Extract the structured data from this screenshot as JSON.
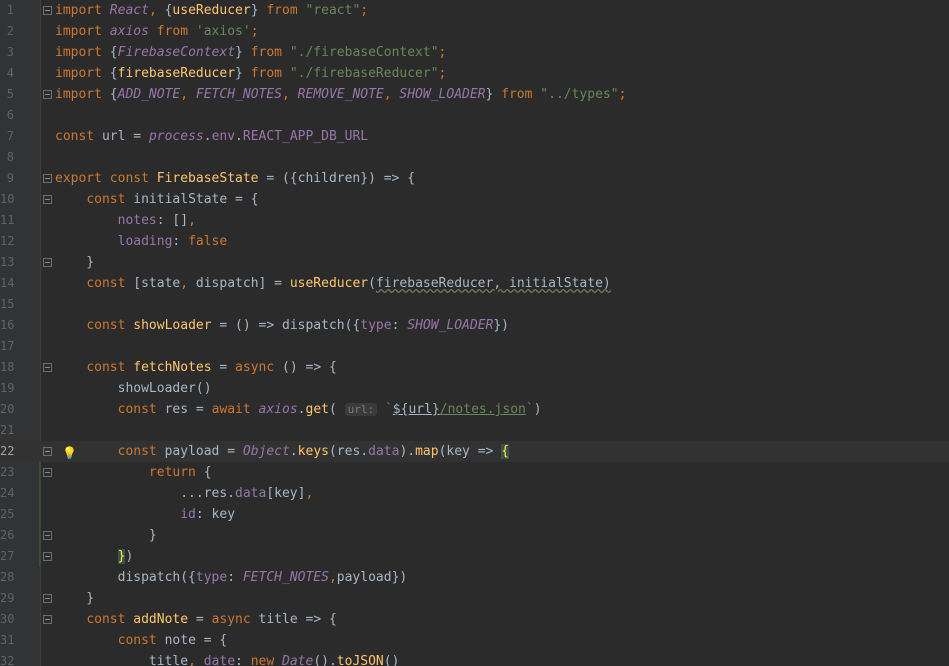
{
  "editor": {
    "current_line": 22,
    "lines": [
      {
        "n": "1",
        "tokens": [
          [
            "kw",
            "import "
          ],
          [
            "it",
            "React"
          ],
          [
            "kw",
            ", "
          ],
          [
            "pl",
            "{"
          ],
          [
            "fn",
            "useReducer"
          ],
          [
            "pl",
            "} "
          ],
          [
            "kw",
            "from "
          ],
          [
            "str",
            "\"react\""
          ],
          [
            "kw",
            ";"
          ]
        ]
      },
      {
        "n": "2",
        "tokens": [
          [
            "kw",
            "import "
          ],
          [
            "it",
            "axios "
          ],
          [
            "kw",
            "from "
          ],
          [
            "str",
            "'axios'"
          ],
          [
            "kw",
            ";"
          ]
        ]
      },
      {
        "n": "3",
        "tokens": [
          [
            "kw",
            "import "
          ],
          [
            "pl",
            "{"
          ],
          [
            "it",
            "FirebaseContext"
          ],
          [
            "pl",
            "} "
          ],
          [
            "kw",
            "from "
          ],
          [
            "str",
            "\"./firebaseContext\""
          ],
          [
            "kw",
            ";"
          ]
        ]
      },
      {
        "n": "4",
        "tokens": [
          [
            "kw",
            "import "
          ],
          [
            "pl",
            "{"
          ],
          [
            "fn",
            "firebaseReducer"
          ],
          [
            "pl",
            "} "
          ],
          [
            "kw",
            "from "
          ],
          [
            "str",
            "\"./firebaseReducer\""
          ],
          [
            "kw",
            ";"
          ]
        ]
      },
      {
        "n": "5",
        "tokens": [
          [
            "kw",
            "import "
          ],
          [
            "pl",
            "{"
          ],
          [
            "it",
            "ADD_NOTE"
          ],
          [
            "kw",
            ", "
          ],
          [
            "it",
            "FETCH_NOTES"
          ],
          [
            "kw",
            ", "
          ],
          [
            "it",
            "REMOVE_NOTE"
          ],
          [
            "kw",
            ", "
          ],
          [
            "it",
            "SHOW_LOADER"
          ],
          [
            "pl",
            "} "
          ],
          [
            "kw",
            "from "
          ],
          [
            "str",
            "\"../types\""
          ],
          [
            "kw",
            ";"
          ]
        ]
      },
      {
        "n": "6",
        "tokens": []
      },
      {
        "n": "7",
        "tokens": [
          [
            "kw",
            "const "
          ],
          [
            "pl",
            "url = "
          ],
          [
            "it",
            "process"
          ],
          [
            "pl",
            "."
          ],
          [
            "prop",
            "env"
          ],
          [
            "pl",
            "."
          ],
          [
            "prop",
            "REACT_APP_DB_URL"
          ]
        ]
      },
      {
        "n": "8",
        "tokens": []
      },
      {
        "n": "9",
        "tokens": [
          [
            "kw",
            "export const "
          ],
          [
            "fn",
            "FirebaseState"
          ],
          [
            "pl",
            " = ({children}) => {"
          ]
        ]
      },
      {
        "n": "10",
        "tokens": [
          [
            "pl",
            "    "
          ],
          [
            "kw",
            "const "
          ],
          [
            "pl",
            "initialState = {"
          ]
        ]
      },
      {
        "n": "11",
        "tokens": [
          [
            "pl",
            "        "
          ],
          [
            "prop",
            "notes"
          ],
          [
            "pl",
            ": []"
          ],
          [
            "kw",
            ","
          ]
        ]
      },
      {
        "n": "12",
        "tokens": [
          [
            "pl",
            "        "
          ],
          [
            "prop",
            "loading"
          ],
          [
            "pl",
            ": "
          ],
          [
            "kw",
            "false"
          ]
        ]
      },
      {
        "n": "13",
        "tokens": [
          [
            "pl",
            "    }"
          ]
        ]
      },
      {
        "n": "14",
        "tokens": [
          [
            "pl",
            "    "
          ],
          [
            "kw",
            "const "
          ],
          [
            "pl",
            "[state"
          ],
          [
            "kw",
            ", "
          ],
          [
            "pl",
            "dispatch] = "
          ],
          [
            "fn",
            "useReducer"
          ],
          [
            "pl",
            "("
          ],
          [
            "wave",
            "firebaseReducer, initialState)"
          ]
        ]
      },
      {
        "n": "15",
        "tokens": []
      },
      {
        "n": "16",
        "tokens": [
          [
            "pl",
            "    "
          ],
          [
            "kw",
            "const "
          ],
          [
            "fn",
            "showLoader"
          ],
          [
            "pl",
            " = () => dispatch({"
          ],
          [
            "prop",
            "type"
          ],
          [
            "pl",
            ": "
          ],
          [
            "it",
            "SHOW_LOADER"
          ],
          [
            "pl",
            "})"
          ]
        ]
      },
      {
        "n": "17",
        "tokens": []
      },
      {
        "n": "18",
        "tokens": [
          [
            "pl",
            "    "
          ],
          [
            "kw",
            "const "
          ],
          [
            "fn",
            "fetchNotes"
          ],
          [
            "pl",
            " = "
          ],
          [
            "kw",
            "async "
          ],
          [
            "pl",
            "() => {"
          ]
        ]
      },
      {
        "n": "19",
        "tokens": [
          [
            "pl",
            "        showLoader()"
          ]
        ]
      },
      {
        "n": "20",
        "tokens": [
          [
            "pl",
            "        "
          ],
          [
            "kw",
            "const "
          ],
          [
            "pl",
            "res = "
          ],
          [
            "kw",
            "await "
          ],
          [
            "it",
            "axios"
          ],
          [
            "pl",
            "."
          ],
          [
            "fn",
            "get"
          ],
          [
            "pl",
            "( "
          ],
          [
            "hint",
            "url:"
          ],
          [
            "pl",
            " "
          ],
          [
            "str",
            "`"
          ],
          [
            "tmpl",
            "${url}"
          ],
          [
            "link",
            "/notes.json"
          ],
          [
            "str",
            "`"
          ],
          [
            "pl",
            ")"
          ]
        ]
      },
      {
        "n": "21",
        "tokens": []
      },
      {
        "n": "22",
        "tokens": [
          [
            "pl",
            "        "
          ],
          [
            "kw",
            "const "
          ],
          [
            "pl",
            "payload = "
          ],
          [
            "it",
            "Object"
          ],
          [
            "pl",
            "."
          ],
          [
            "fn",
            "keys"
          ],
          [
            "pl",
            "(res."
          ],
          [
            "prop",
            "data"
          ],
          [
            "pl",
            ")."
          ],
          [
            "fn",
            "map"
          ],
          [
            "pl",
            "(key => "
          ],
          [
            "hl",
            "{"
          ]
        ]
      },
      {
        "n": "23",
        "tokens": [
          [
            "pl",
            "            "
          ],
          [
            "kw",
            "return "
          ],
          [
            "pl",
            "{"
          ]
        ]
      },
      {
        "n": "24",
        "tokens": [
          [
            "pl",
            "                ...res."
          ],
          [
            "prop",
            "data"
          ],
          [
            "pl",
            "[key]"
          ],
          [
            "kw",
            ","
          ]
        ]
      },
      {
        "n": "25",
        "tokens": [
          [
            "pl",
            "                "
          ],
          [
            "prop",
            "id"
          ],
          [
            "pl",
            ": key"
          ]
        ]
      },
      {
        "n": "26",
        "tokens": [
          [
            "pl",
            "            }"
          ]
        ]
      },
      {
        "n": "27",
        "tokens": [
          [
            "pl",
            "        "
          ],
          [
            "hl",
            "}"
          ],
          [
            "pl",
            ")"
          ]
        ]
      },
      {
        "n": "28",
        "tokens": [
          [
            "pl",
            "        dispatch({"
          ],
          [
            "prop",
            "type"
          ],
          [
            "pl",
            ": "
          ],
          [
            "it",
            "FETCH_NOTES"
          ],
          [
            "kw",
            ","
          ],
          [
            "pl",
            "payload})"
          ]
        ]
      },
      {
        "n": "29",
        "tokens": [
          [
            "pl",
            "    }"
          ]
        ]
      },
      {
        "n": "30",
        "tokens": [
          [
            "pl",
            "    "
          ],
          [
            "kw",
            "const "
          ],
          [
            "fn",
            "addNote"
          ],
          [
            "pl",
            " = "
          ],
          [
            "kw",
            "async "
          ],
          [
            "pl",
            "title => {"
          ]
        ]
      },
      {
        "n": "31",
        "tokens": [
          [
            "pl",
            "        "
          ],
          [
            "kw",
            "const "
          ],
          [
            "pl",
            "note = {"
          ]
        ]
      },
      {
        "n": "32",
        "tokens": [
          [
            "pl",
            "            title"
          ],
          [
            "kw",
            ", "
          ],
          [
            "prop",
            "date"
          ],
          [
            "pl",
            ": "
          ],
          [
            "kw",
            "new "
          ],
          [
            "it",
            "Date"
          ],
          [
            "pl",
            "()."
          ],
          [
            "fn",
            "toJSON"
          ],
          [
            "pl",
            "()"
          ]
        ]
      }
    ],
    "fold_lines": [
      "1",
      "5",
      "9",
      "10",
      "13",
      "18",
      "22",
      "23",
      "26",
      "27",
      "29",
      "30"
    ],
    "bulb_line": "22",
    "bulb_icon": "lightbulb-icon"
  }
}
